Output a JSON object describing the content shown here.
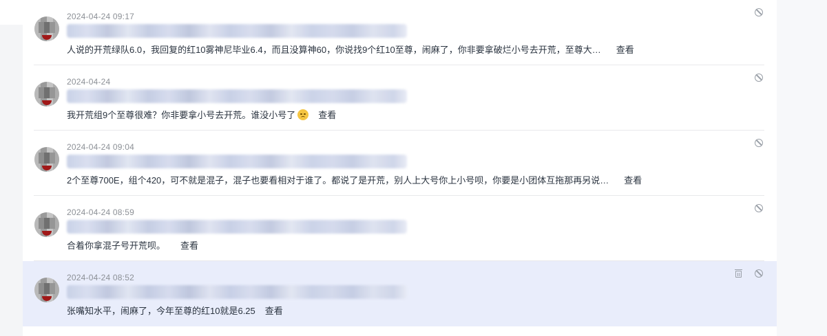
{
  "comments": [
    {
      "time": "2024-04-24 09:17",
      "text": "人说的开荒绿队6.0，我回复的红10雾神尼毕业6.4，而且没算神60，你说找9个红10至尊，闹麻了，你非要拿破烂小号去开荒，至尊大…",
      "view_label": "查看",
      "has_emoji": false
    },
    {
      "time": "2024-04-24",
      "text": "我开荒组9个至尊很难？你非要拿小号去开荒。谁没小号了",
      "view_label": "查看",
      "has_emoji": true
    },
    {
      "time": "2024-04-24 09:04",
      "text": "2个至尊700E，组个420，可不就是混子，混子也要看相对于谁了。都说了是开荒，别人上大号你上小号呗，你要是小团体互拖那再另说…",
      "view_label": "查看",
      "has_emoji": false
    },
    {
      "time": "2024-04-24 08:59",
      "text": "合着你拿混子号开荒呗。",
      "view_label": "查看",
      "has_emoji": false
    },
    {
      "time": "2024-04-24 08:52",
      "text": "张嘴知水平，闹麻了，今年至尊的红10就是6.25",
      "view_label": "查看",
      "has_emoji": false
    }
  ],
  "icons": {
    "block": "block-icon",
    "delete": "trash-icon"
  },
  "colors": {
    "highlight_row": "#e9edfb",
    "text": "#2b3440",
    "timestamp": "#8c9096"
  }
}
